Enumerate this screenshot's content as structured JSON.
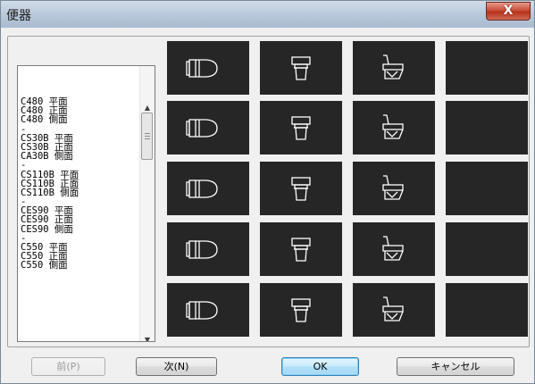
{
  "window": {
    "title": "便器",
    "close_glyph": "X"
  },
  "list": {
    "items": [
      "C480 平面",
      "C480 正面",
      "C480 側面",
      "-",
      "CS30B 平面",
      "CS30B 正面",
      "CA30B 側面",
      "-",
      "CS110B 平面",
      "CS110B 正面",
      "CS110B 側面",
      "-",
      "CES90 平面",
      "CES90 正面",
      "CES90 側面",
      "-",
      "C550 平面",
      "C550 正面",
      "C550 側面"
    ],
    "scroll_up": "▲",
    "scroll_down": "▼"
  },
  "thumbnails": [
    {
      "icon": "toilet-plan-icon"
    },
    {
      "icon": "toilet-front-icon"
    },
    {
      "icon": "toilet-side-icon"
    },
    {
      "icon": "empty"
    },
    {
      "icon": "toilet-plan-icon"
    },
    {
      "icon": "toilet-front-icon"
    },
    {
      "icon": "toilet-side-icon"
    },
    {
      "icon": "empty"
    },
    {
      "icon": "toilet-plan-icon"
    },
    {
      "icon": "toilet-front-icon"
    },
    {
      "icon": "toilet-side-icon"
    },
    {
      "icon": "empty"
    },
    {
      "icon": "toilet-plan-icon"
    },
    {
      "icon": "toilet-front-icon"
    },
    {
      "icon": "toilet-side-icon"
    },
    {
      "icon": "empty"
    },
    {
      "icon": "toilet-plan-icon"
    },
    {
      "icon": "toilet-front-icon"
    },
    {
      "icon": "toilet-side-icon"
    },
    {
      "icon": "empty"
    }
  ],
  "buttons": {
    "prev": "前(P)",
    "next": "次(N)",
    "ok": "OK",
    "cancel": "キャンセル"
  }
}
